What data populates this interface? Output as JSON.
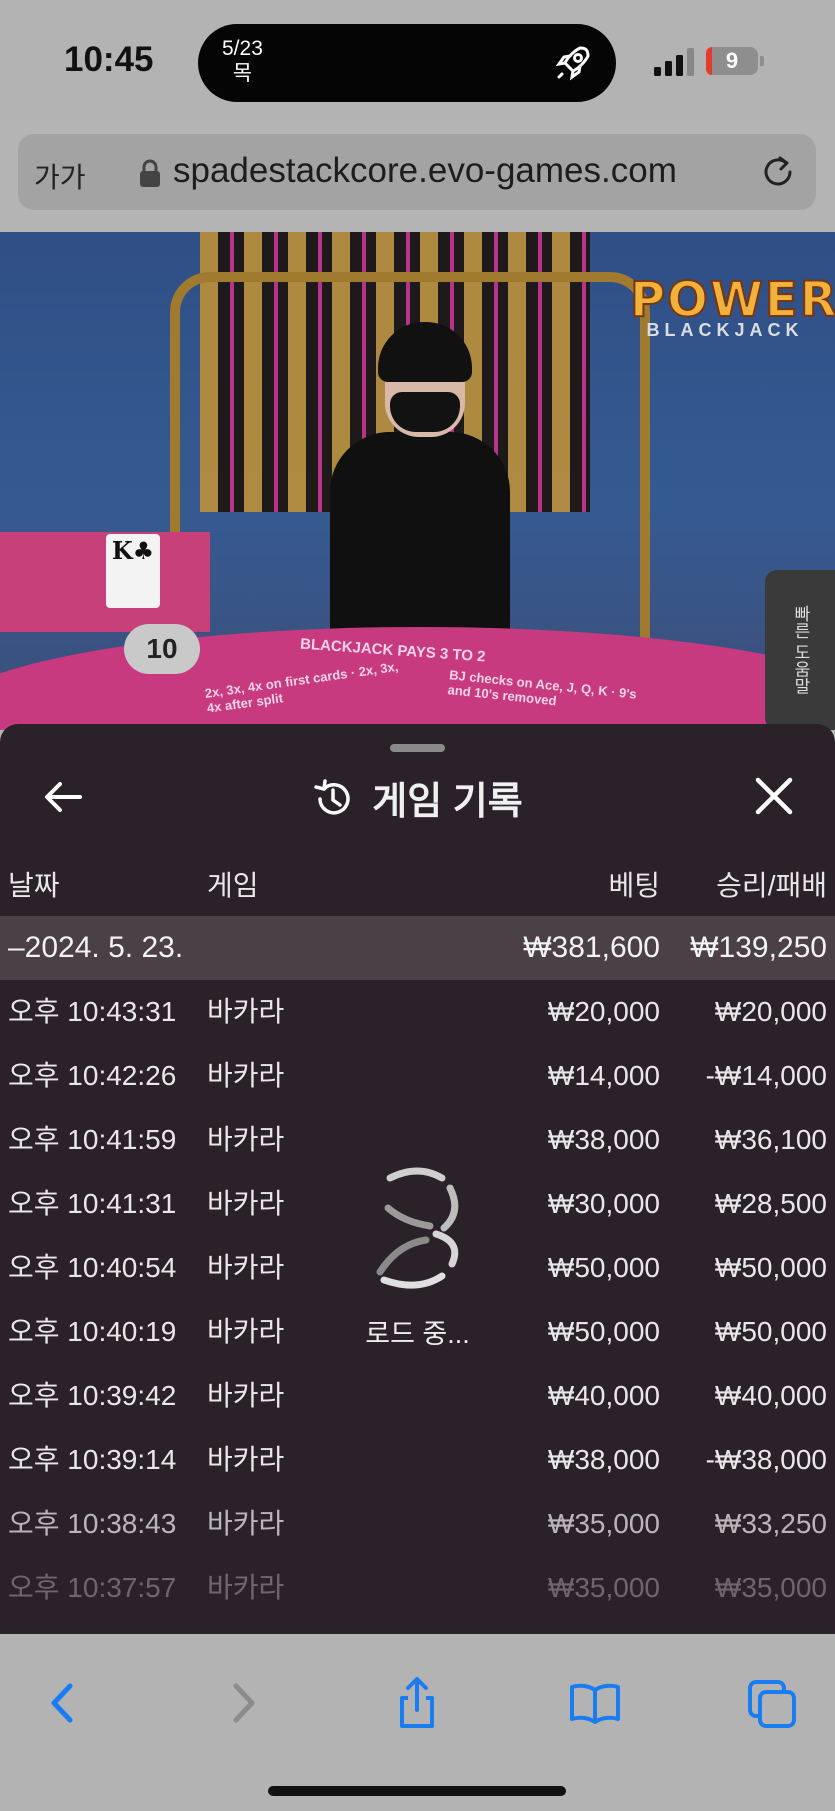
{
  "status_bar": {
    "time": "10:45",
    "island_date": "5/23",
    "island_weekday": "목",
    "battery": "9"
  },
  "address_bar": {
    "text_size_label": "가가",
    "url": "spadestackcore.evo-games.com"
  },
  "game_view": {
    "logo_main": "POWER",
    "logo_sub": "BLACKJACK",
    "dealer_card": "K♣",
    "dealer_score": "10",
    "table_text_left": "2x, 3x, 4x on first cards · 2x, 3x, 4x after split",
    "table_text_center": "BLACKJACK PAYS 3 TO 2",
    "table_text_right": "BJ checks on Ace, J, Q, K · 9's and 10's removed",
    "quick_help_label": "빠른 도움말"
  },
  "history_panel": {
    "title": "게임 기록",
    "headers": {
      "date": "날짜",
      "game": "게임",
      "bet": "베팅",
      "win_loss": "승리/패배"
    },
    "summary": {
      "date": "–2024. 5. 23.",
      "bet": "₩381,600",
      "win_loss": "₩139,250"
    },
    "rows": [
      {
        "time": "오후 10:43:31",
        "game": "바카라",
        "bet": "₩20,000",
        "win_loss": "₩20,000"
      },
      {
        "time": "오후 10:42:26",
        "game": "바카라",
        "bet": "₩14,000",
        "win_loss": "-₩14,000"
      },
      {
        "time": "오후 10:41:59",
        "game": "바카라",
        "bet": "₩38,000",
        "win_loss": "₩36,100"
      },
      {
        "time": "오후 10:41:31",
        "game": "바카라",
        "bet": "₩30,000",
        "win_loss": "₩28,500"
      },
      {
        "time": "오후 10:40:54",
        "game": "바카라",
        "bet": "₩50,000",
        "win_loss": "₩50,000"
      },
      {
        "time": "오후 10:40:19",
        "game": "바카라",
        "bet": "₩50,000",
        "win_loss": "₩50,000"
      },
      {
        "time": "오후 10:39:42",
        "game": "바카라",
        "bet": "₩40,000",
        "win_loss": "₩40,000"
      },
      {
        "time": "오후 10:39:14",
        "game": "바카라",
        "bet": "₩38,000",
        "win_loss": "-₩38,000"
      },
      {
        "time": "오후 10:38:43",
        "game": "바카라",
        "bet": "₩35,000",
        "win_loss": "₩33,250"
      },
      {
        "time": "오후 10:37:57",
        "game": "바카라",
        "bet": "₩35,000",
        "win_loss": "₩35,000"
      }
    ],
    "loading_text": "로드 중..."
  },
  "colors": {
    "accent_blue": "#1a7cf2",
    "panel_bg": "#2b2128",
    "table_pink": "#c83a7f"
  }
}
